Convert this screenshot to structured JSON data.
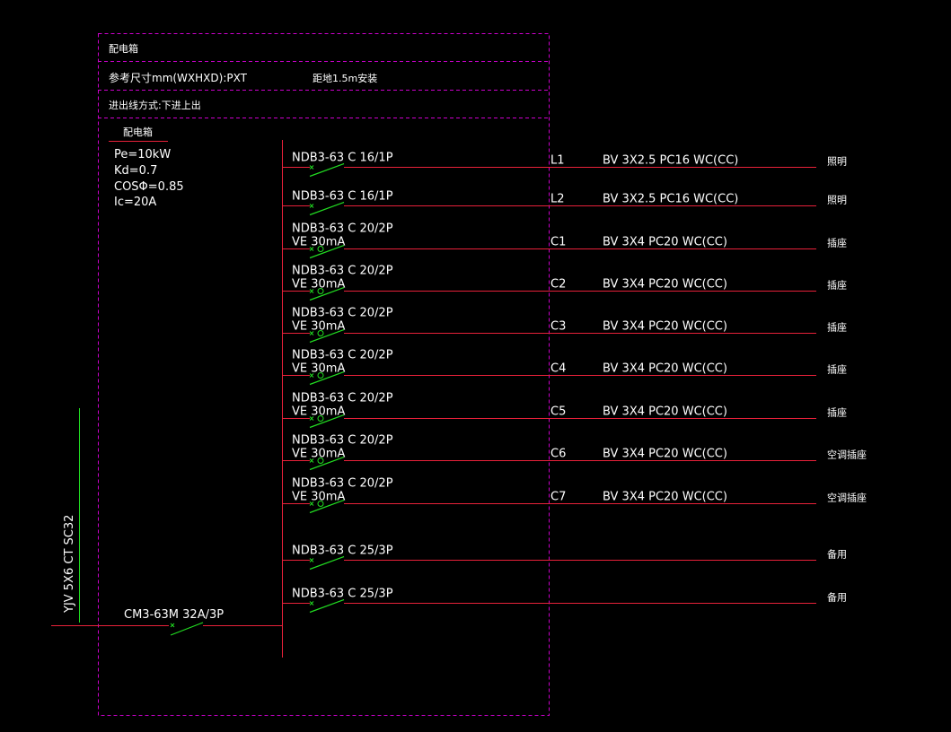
{
  "header": {
    "title": "配电箱",
    "size_label": "参考尺寸mm(WXHXD):PXT",
    "install_note": "距地1.5m安装",
    "wiring": "进出线方式:下进上出"
  },
  "panel": {
    "name": "配电箱",
    "pe": "Pe=10kW",
    "kd": "Kd=0.7",
    "cos": "COSΦ=0.85",
    "ic": "Ic=20A"
  },
  "incoming": {
    "cable": "YJV 5X6 CT SC32",
    "breaker": "CM3-63M 32A/3P"
  },
  "circuits": [
    {
      "breaker": "NDB3-63 C 16/1P",
      "rcd": "",
      "id": "L1",
      "cable": "BV 3X2.5 PC16 WC(CC)",
      "use": "照明"
    },
    {
      "breaker": "NDB3-63 C 16/1P",
      "rcd": "",
      "id": "L2",
      "cable": "BV 3X2.5 PC16 WC(CC)",
      "use": "照明"
    },
    {
      "breaker": "NDB3-63 C 20/2P",
      "rcd": "VE 30mA",
      "id": "C1",
      "cable": "BV 3X4 PC20 WC(CC)",
      "use": "插座"
    },
    {
      "breaker": "NDB3-63 C 20/2P",
      "rcd": "VE 30mA",
      "id": "C2",
      "cable": "BV 3X4 PC20 WC(CC)",
      "use": "插座"
    },
    {
      "breaker": "NDB3-63 C 20/2P",
      "rcd": "VE 30mA",
      "id": "C3",
      "cable": "BV 3X4 PC20 WC(CC)",
      "use": "插座"
    },
    {
      "breaker": "NDB3-63 C 20/2P",
      "rcd": "VE 30mA",
      "id": "C4",
      "cable": "BV 3X4 PC20 WC(CC)",
      "use": "插座"
    },
    {
      "breaker": "NDB3-63 C 20/2P",
      "rcd": "VE 30mA",
      "id": "C5",
      "cable": "BV 3X4 PC20 WC(CC)",
      "use": "插座"
    },
    {
      "breaker": "NDB3-63 C 20/2P",
      "rcd": "VE 30mA",
      "id": "C6",
      "cable": "BV 3X4 PC20 WC(CC)",
      "use": "空调插座"
    },
    {
      "breaker": "NDB3-63 C 20/2P",
      "rcd": "VE 30mA",
      "id": "C7",
      "cable": "BV 3X4 PC20 WC(CC)",
      "use": "空调插座"
    },
    {
      "breaker": "NDB3-63 C 25/3P",
      "rcd": "",
      "id": "",
      "cable": "",
      "use": "备用"
    },
    {
      "breaker": "NDB3-63 C 25/3P",
      "rcd": "",
      "id": "",
      "cable": "",
      "use": "备用"
    }
  ],
  "colors": {
    "background": "#000000",
    "frame": "#cc00cc",
    "line": "#e8213a",
    "switch": "#22dd22",
    "text": "#ffffff"
  }
}
